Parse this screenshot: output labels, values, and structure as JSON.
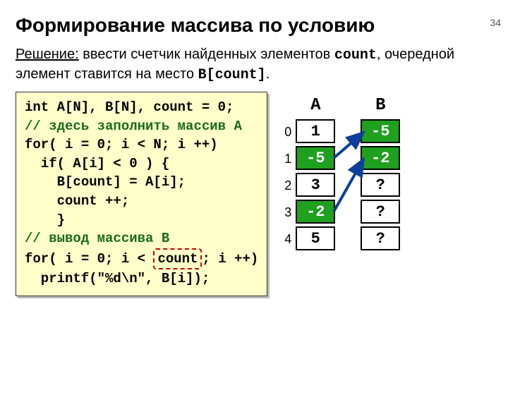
{
  "page_number": "34",
  "title": "Формирование массива по условию",
  "desc": {
    "lead": "Решение:",
    "part1a": " ввести счетчик найденных элементов ",
    "count_word": "count",
    "part1b": ", очередной элемент ставится на место ",
    "bcount": "B[count]",
    "tail": "."
  },
  "code": {
    "l1": "int A[N], B[N], count = 0;",
    "l2": "// здесь заполнить массив A",
    "l3": "for( i = 0; i < N; i ++)",
    "l4": "  if( A[i] < 0 ) {",
    "l5": "    B[count] = A[i];",
    "l6": "    count ++;",
    "l7": "    }",
    "l8": "// вывод массива B",
    "l9a": "for( i = 0; i < ",
    "count_box": "count",
    "l9b": "; i ++)",
    "l10": "  printf(\"%d\\n\", B[i]);"
  },
  "table": {
    "hA": "A",
    "hB": "B",
    "idx": [
      "0",
      "1",
      "2",
      "3",
      "4"
    ],
    "A": [
      {
        "v": "1",
        "neg": false
      },
      {
        "v": "-5",
        "neg": true
      },
      {
        "v": "3",
        "neg": false
      },
      {
        "v": "-2",
        "neg": true
      },
      {
        "v": "5",
        "neg": false
      }
    ],
    "B": [
      {
        "v": "-5",
        "neg": true
      },
      {
        "v": "-2",
        "neg": true
      },
      {
        "v": "?",
        "neg": false
      },
      {
        "v": "?",
        "neg": false
      },
      {
        "v": "?",
        "neg": false
      }
    ]
  }
}
